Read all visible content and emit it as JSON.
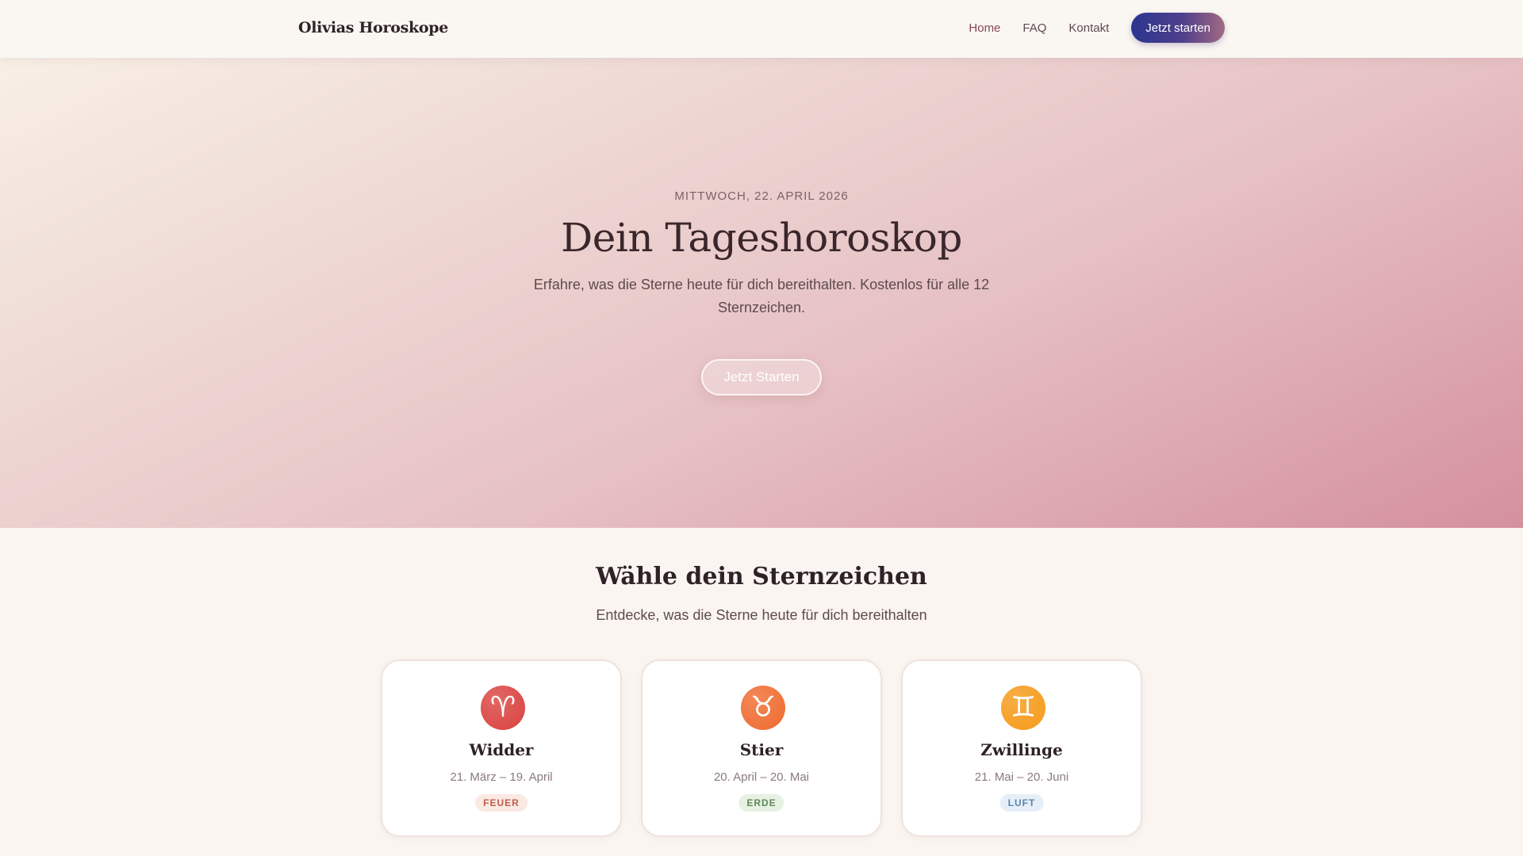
{
  "nav": {
    "brand": "Olivias Horoskope",
    "links": [
      "Home",
      "FAQ",
      "Kontakt"
    ],
    "cta": "Jetzt starten"
  },
  "hero": {
    "date": "MITTWOCH, 22. APRIL 2026",
    "title": "Dein Tageshoroskop",
    "subtitle": "Erfahre, was die Sterne heute für dich bereithalten. Kostenlos für alle 12 Sternzeichen.",
    "cta": "Jetzt Starten"
  },
  "signs_section": {
    "title": "Wähle dein Sternzeichen",
    "subtitle": "Entdecke, was die Sterne heute für dich bereithalten"
  },
  "signs": [
    {
      "symbol": "♈",
      "icon": "aries-icon",
      "name": "Widder",
      "dates": "21. März – 19. April",
      "element": "FEUER",
      "color": "#d9423f",
      "badge_bg": "#fbe9e3",
      "badge_fg": "#c0604c"
    },
    {
      "symbol": "♉",
      "icon": "taurus-icon",
      "name": "Stier",
      "dates": "20. April – 20. Mai",
      "element": "ERDE",
      "color": "#ef6a2e",
      "badge_bg": "#e7f1e3",
      "badge_fg": "#5c8a55"
    },
    {
      "symbol": "♊",
      "icon": "gemini-icon",
      "name": "Zwillinge",
      "dates": "21. Mai – 20. Juni",
      "element": "LUFT",
      "color": "#f59a18",
      "badge_bg": "#e6eff7",
      "badge_fg": "#5a86b0"
    }
  ]
}
